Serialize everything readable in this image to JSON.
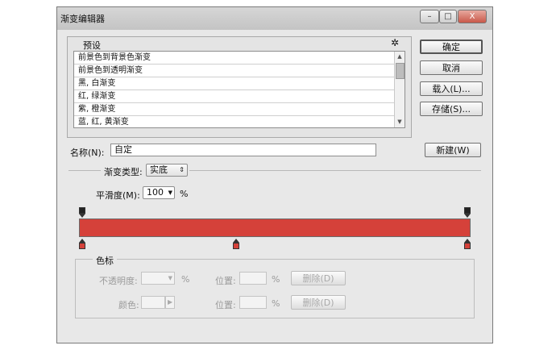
{
  "window": {
    "title": "渐变编辑器",
    "minimize": "–",
    "maximize": "□",
    "close": "X"
  },
  "presets": {
    "label": "预设",
    "gear": "✲",
    "items": [
      "前景色到背景色渐变",
      "前景色到透明渐变",
      "黑, 白渐变",
      "红, 绿渐变",
      "紫, 橙渐变",
      "蓝, 红, 黄渐变"
    ]
  },
  "buttons": {
    "ok": "确定",
    "cancel": "取消",
    "load": "载入(L)...",
    "save": "存储(S)...",
    "new": "新建(W)"
  },
  "name": {
    "label": "名称(N):",
    "value": "自定"
  },
  "gradient": {
    "type_label": "渐变类型:",
    "type_value": "实底",
    "smooth_label": "平滑度(M):",
    "smooth_value": "100",
    "smooth_unit": "%",
    "color": "#d5413a",
    "opacity_stops": [
      0,
      1
    ],
    "color_stops": [
      0,
      0.4,
      1
    ]
  },
  "stops": {
    "group_label": "色标",
    "opacity_label": "不透明度:",
    "opacity_unit": "%",
    "position_label": "位置:",
    "position_unit": "%",
    "delete": "删除(D)",
    "color_label": "颜色:",
    "color2_position_label": "位置:",
    "color2_position_unit": "%",
    "delete2": "删除(D)"
  }
}
